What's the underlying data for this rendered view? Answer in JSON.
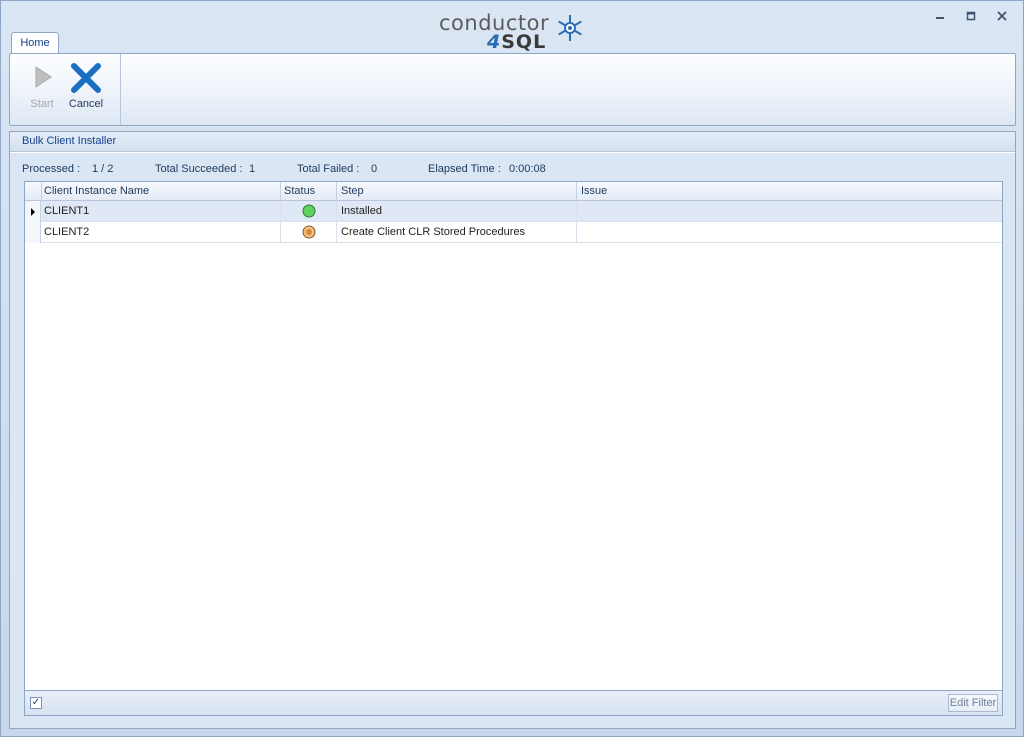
{
  "app": {
    "logo_text_top": "conductor",
    "logo_text_four": "4",
    "logo_text_sql": "SQL",
    "window_controls": [
      "minimize-icon",
      "restore-icon",
      "close-icon"
    ]
  },
  "ribbon": {
    "tabs": [
      {
        "label": "Home"
      }
    ],
    "buttons": {
      "start_label": "Start",
      "cancel_label": "Cancel"
    }
  },
  "panel": {
    "title": "Bulk Client Installer",
    "stats": {
      "processed_label": "Processed :",
      "processed_value": "1 / 2",
      "succeeded_label": "Total Succeeded :",
      "succeeded_value": "1",
      "failed_label": "Total Failed :",
      "failed_value": "0",
      "elapsed_label": "Elapsed Time :",
      "elapsed_value": "0:00:08"
    },
    "grid": {
      "columns": [
        "Client Instance Name",
        "Status",
        "Step",
        "Issue"
      ],
      "rows": [
        {
          "name": "CLIENT1",
          "status": "success",
          "status_color": "#3fb83f",
          "step": "Installed",
          "issue": ""
        },
        {
          "name": "CLIENT2",
          "status": "in-progress",
          "status_color": "#d98a2b",
          "step": "Create Client CLR Stored Procedures",
          "issue": ""
        }
      ]
    },
    "footer": {
      "edit_filter_label": "Edit Filter"
    }
  },
  "colors": {
    "accent": "#15428b",
    "cancel_icon": "#1b6fc2"
  }
}
